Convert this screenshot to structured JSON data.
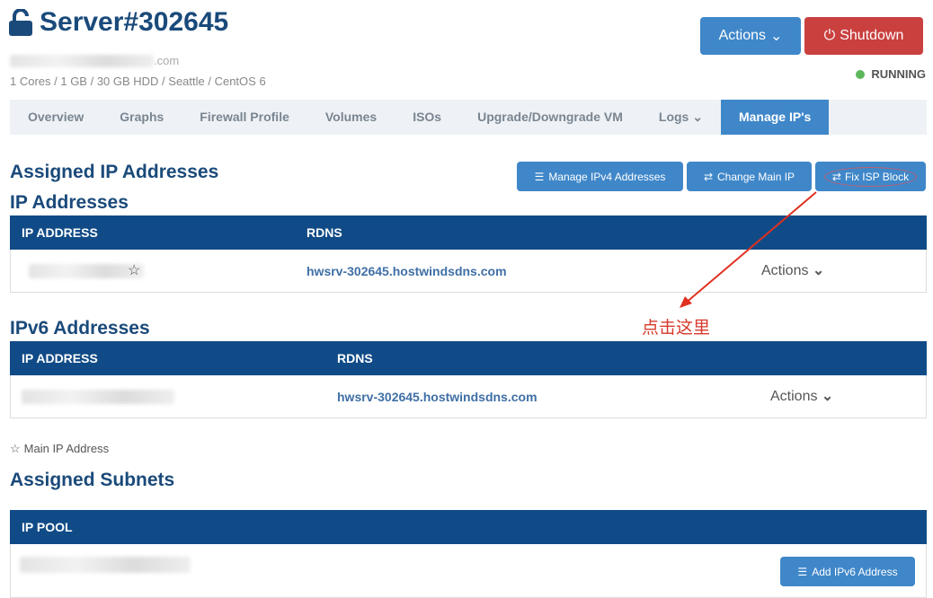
{
  "header": {
    "title": "Server#302645",
    "hostname_suffix": ".com",
    "specs": "1 Cores / 1 GB / 30 GB HDD / Seattle / CentOS 6",
    "actions_label": "Actions",
    "shutdown_label": "Shutdown",
    "status": "RUNNING",
    "status_color": "#5cb85c"
  },
  "tabs": [
    {
      "label": "Overview"
    },
    {
      "label": "Graphs"
    },
    {
      "label": "Firewall Profile"
    },
    {
      "label": "Volumes"
    },
    {
      "label": "ISOs"
    },
    {
      "label": "Upgrade/Downgrade VM"
    },
    {
      "label": "Logs"
    },
    {
      "label": "Manage IP's"
    }
  ],
  "assigned": {
    "title": "Assigned IP Addresses",
    "manage_ipv4": "Manage IPv4 Addresses",
    "change_main": "Change Main IP",
    "fix_isp": "Fix ISP Block"
  },
  "ipv4": {
    "title": "IP Addresses",
    "col_ip": "IP ADDRESS",
    "col_rdns": "RDNS",
    "rdns": "hwsrv-302645.hostwindsdns.com",
    "actions": "Actions"
  },
  "ipv6": {
    "title": "IPv6 Addresses",
    "col_ip": "IP ADDRESS",
    "col_rdns": "RDNS",
    "rdns": "hwsrv-302645.hostwindsdns.com",
    "actions": "Actions"
  },
  "legend": {
    "main_ip": "Main IP Address"
  },
  "subnets": {
    "title": "Assigned Subnets",
    "col_pool": "IP POOL",
    "add_ipv6": "Add IPv6 Address"
  },
  "annotation": {
    "text": "点击这里",
    "color": "#d63a2a"
  }
}
